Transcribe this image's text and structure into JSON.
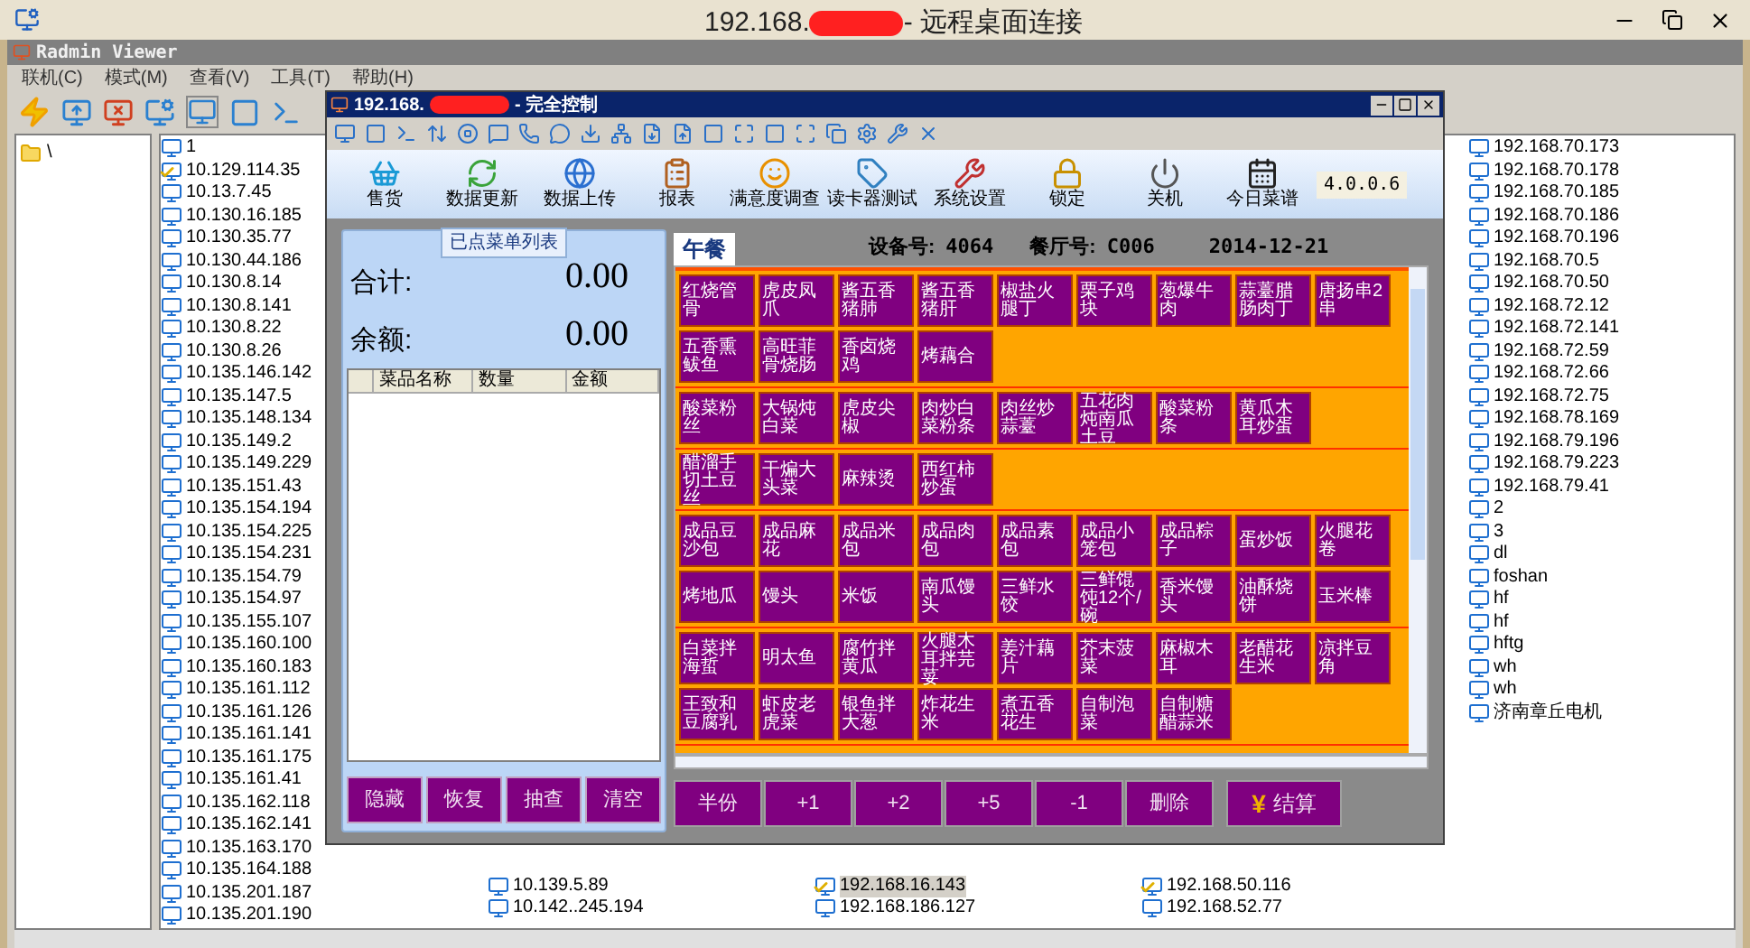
{
  "remote_title": {
    "prefix": "192.168.",
    "suffix": "- 远程桌面连接"
  },
  "viewer": {
    "title": "Radmin Viewer",
    "menu": [
      "联机(C)",
      "模式(M)",
      "查看(V)",
      "工具(T)",
      "帮助(H)"
    ],
    "tree": [
      {
        "label": "\\",
        "selected": false
      }
    ],
    "host_columns": [
      [
        {
          "label": "1",
          "checked": false,
          "selected": false
        },
        {
          "label": "10.129.114.35",
          "checked": true,
          "selected": false
        },
        {
          "label": "10.13.7.45",
          "checked": false,
          "selected": false
        },
        {
          "label": "10.130.16.185",
          "checked": false,
          "selected": false
        },
        {
          "label": "10.130.35.77",
          "checked": false,
          "selected": false
        },
        {
          "label": "10.130.44.186",
          "checked": false,
          "selected": false
        },
        {
          "label": "10.130.8.14",
          "checked": false,
          "selected": false
        },
        {
          "label": "10.130.8.141",
          "checked": false,
          "selected": false
        },
        {
          "label": "10.130.8.22",
          "checked": false,
          "selected": false
        },
        {
          "label": "10.130.8.26",
          "checked": false,
          "selected": false
        },
        {
          "label": "10.135.146.142",
          "checked": false,
          "selected": false
        },
        {
          "label": "10.135.147.5",
          "checked": false,
          "selected": false
        },
        {
          "label": "10.135.148.134",
          "checked": false,
          "selected": false
        },
        {
          "label": "10.135.149.2",
          "checked": false,
          "selected": false
        },
        {
          "label": "10.135.149.229",
          "checked": false,
          "selected": false
        },
        {
          "label": "10.135.151.43",
          "checked": false,
          "selected": false
        },
        {
          "label": "10.135.154.194",
          "checked": false,
          "selected": false
        },
        {
          "label": "10.135.154.225",
          "checked": false,
          "selected": false
        },
        {
          "label": "10.135.154.231",
          "checked": false,
          "selected": false
        },
        {
          "label": "10.135.154.79",
          "checked": false,
          "selected": false
        },
        {
          "label": "10.135.154.97",
          "checked": false,
          "selected": false
        },
        {
          "label": "10.135.155.107",
          "checked": false,
          "selected": false
        },
        {
          "label": "10.135.160.100",
          "checked": false,
          "selected": false
        },
        {
          "label": "10.135.160.183",
          "checked": false,
          "selected": false
        },
        {
          "label": "10.135.161.112",
          "checked": false,
          "selected": false
        },
        {
          "label": "10.135.161.126",
          "checked": false,
          "selected": false
        },
        {
          "label": "10.135.161.141",
          "checked": false,
          "selected": false
        },
        {
          "label": "10.135.161.175",
          "checked": false,
          "selected": false
        },
        {
          "label": "10.135.161.41",
          "checked": false,
          "selected": false
        },
        {
          "label": "10.135.162.118",
          "checked": false,
          "selected": false
        },
        {
          "label": "10.135.162.141",
          "checked": false,
          "selected": false
        },
        {
          "label": "10.135.163.170",
          "checked": false,
          "selected": false
        },
        {
          "label": "10.135.164.188",
          "checked": false,
          "selected": false
        },
        {
          "label": "10.135.201.187",
          "checked": false,
          "selected": false
        },
        {
          "label": "10.135.201.190",
          "checked": false,
          "selected": false
        }
      ],
      [
        {
          "label": "10.139.5.89",
          "checked": false,
          "selected": false
        },
        {
          "label": "10.142..245.194",
          "checked": false,
          "selected": false
        }
      ],
      [
        {
          "label": "192.168.16.143",
          "checked": true,
          "selected": true
        },
        {
          "label": "192.168.186.127",
          "checked": false,
          "selected": false
        }
      ],
      [
        {
          "label": "192.168.50.116",
          "checked": true,
          "selected": false
        },
        {
          "label": "192.168.52.77",
          "checked": false,
          "selected": false
        }
      ],
      [
        {
          "label": "192.168.70.173",
          "checked": false,
          "selected": false
        },
        {
          "label": "192.168.70.178",
          "checked": false,
          "selected": false
        },
        {
          "label": "192.168.70.185",
          "checked": false,
          "selected": false
        },
        {
          "label": "192.168.70.186",
          "checked": false,
          "selected": false
        },
        {
          "label": "192.168.70.196",
          "checked": false,
          "selected": false
        },
        {
          "label": "192.168.70.5",
          "checked": false,
          "selected": false
        },
        {
          "label": "192.168.70.50",
          "checked": false,
          "selected": false
        },
        {
          "label": "192.168.72.12",
          "checked": false,
          "selected": false
        },
        {
          "label": "192.168.72.141",
          "checked": false,
          "selected": false
        },
        {
          "label": "192.168.72.59",
          "checked": false,
          "selected": false
        },
        {
          "label": "192.168.72.66",
          "checked": false,
          "selected": false
        },
        {
          "label": "192.168.72.75",
          "checked": false,
          "selected": false
        },
        {
          "label": "192.168.78.169",
          "checked": false,
          "selected": false
        },
        {
          "label": "192.168.79.196",
          "checked": false,
          "selected": false
        },
        {
          "label": "192.168.79.223",
          "checked": false,
          "selected": false
        },
        {
          "label": "192.168.79.41",
          "checked": false,
          "selected": false
        },
        {
          "label": "2",
          "checked": false,
          "selected": false
        },
        {
          "label": "3",
          "checked": false,
          "selected": false
        },
        {
          "label": "dl",
          "checked": false,
          "selected": false
        },
        {
          "label": "foshan",
          "checked": false,
          "selected": false
        },
        {
          "label": "hf",
          "checked": false,
          "selected": false
        },
        {
          "label": "hf",
          "checked": false,
          "selected": false
        },
        {
          "label": "hftg",
          "checked": false,
          "selected": false
        },
        {
          "label": "wh",
          "checked": false,
          "selected": false
        },
        {
          "label": "wh",
          "checked": false,
          "selected": false
        },
        {
          "label": "济南章丘电机",
          "checked": false,
          "selected": false
        }
      ]
    ]
  },
  "control_window": {
    "title_prefix": "192.168.",
    "title_suffix": "- 完全控制",
    "ribbon": [
      {
        "label": "售货",
        "kind": "sales"
      },
      {
        "label": "数据更新",
        "kind": "refresh"
      },
      {
        "label": "数据上传",
        "kind": "upload"
      },
      {
        "label": "报表",
        "kind": "report"
      },
      {
        "label": "满意度调查",
        "kind": "survey"
      },
      {
        "label": "读卡器测试",
        "kind": "card"
      },
      {
        "label": "系统设置",
        "kind": "settings"
      },
      {
        "label": "锁定",
        "kind": "lock"
      },
      {
        "label": "关机",
        "kind": "power"
      },
      {
        "label": "今日菜谱",
        "kind": "menu"
      }
    ],
    "version": "4.0.0.6",
    "order_panel": {
      "title": "已点菜单列表",
      "total_label": "合计:",
      "total": "0.00",
      "balance_label": "余额:",
      "balance": "0.00",
      "columns": [
        "菜品名称",
        "数量",
        "金额"
      ],
      "buttons": [
        "隐藏",
        "恢复",
        "抽查",
        "清空"
      ]
    },
    "tabs": [
      {
        "label": "午餐",
        "selected": true
      }
    ],
    "info": [
      {
        "label": "设备号:",
        "value": "4064"
      },
      {
        "label": "餐厅号:",
        "value": "C006"
      }
    ],
    "date": "2014-12-21",
    "dish_sections": [
      [
        "红烧管骨",
        "虎皮凤爪",
        "酱五香猪肺",
        "酱五香猪肝",
        "椒盐火腿丁",
        "栗子鸡块",
        "葱爆牛肉",
        "蒜薹腊肠肉丁",
        "唐扬串2串",
        "五香熏鲅鱼",
        "高旺菲骨烧肠",
        "香卤烧鸡",
        "烤藕合"
      ],
      [
        "酸菜粉丝",
        "大锅炖白菜",
        "虎皮尖椒",
        "肉炒白菜粉条",
        "肉丝炒蒜薹",
        "五花肉炖南瓜土豆",
        "酸菜粉条",
        "黄瓜木耳炒蛋"
      ],
      [
        "醋溜手切土豆丝",
        "干煸大头菜",
        "麻辣烫",
        "西红柿炒蛋"
      ],
      [
        "成品豆沙包",
        "成品麻花",
        "成品米包",
        "成品肉包",
        "成品素包",
        "成品小笼包",
        "成品粽子",
        "蛋炒饭",
        "火腿花卷",
        "烤地瓜",
        "馒头",
        "米饭",
        "南瓜馒头",
        "三鲜水饺",
        "三鲜馄饨12个/碗",
        "香米馒头",
        "油酥烧饼",
        "玉米棒"
      ],
      [
        "白菜拌海蜇",
        "明太鱼",
        "腐竹拌黄瓜",
        "火腿木耳拌芫荽",
        "姜汁藕片",
        "芥末菠菜",
        "麻椒木耳",
        "老醋花生米",
        "凉拌豆角",
        "王致和豆腐乳",
        "虾皮老虎菜",
        "银鱼拌大葱",
        "炸花生米",
        "煮五香花生",
        "自制泡菜",
        "自制糖醋蒜米"
      ]
    ],
    "actions": [
      {
        "label": "半份",
        "kind": "plain"
      },
      {
        "label": "+1",
        "kind": "plain"
      },
      {
        "label": "+2",
        "kind": "plain"
      },
      {
        "label": "+5",
        "kind": "plain"
      },
      {
        "label": "-1",
        "kind": "plain"
      },
      {
        "label": "删除",
        "kind": "plain"
      },
      {
        "label": "结算",
        "kind": "checkout",
        "symbol": "¥"
      }
    ]
  }
}
